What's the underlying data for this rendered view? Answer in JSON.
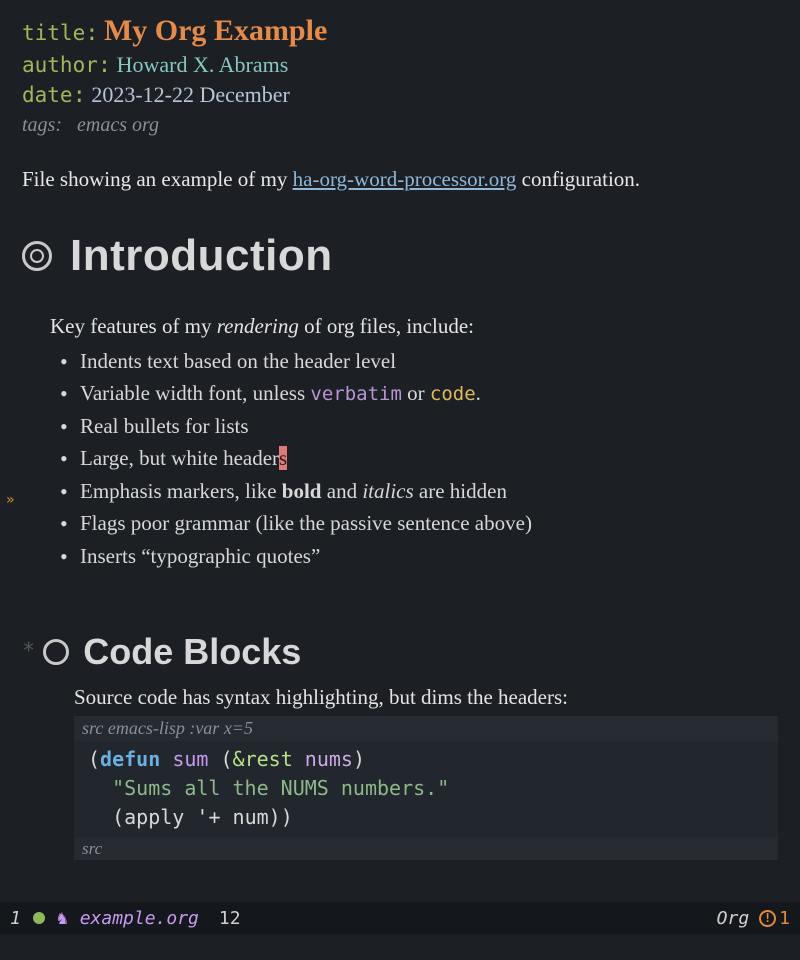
{
  "meta": {
    "title_key": "title",
    "title_val": "My Org Example",
    "author_key": "author",
    "author_val": "Howard X. Abrams",
    "date_key": "date",
    "date_val": "2023-12-22 December",
    "tags_key": "tags:",
    "tags_val": "emacs org"
  },
  "intro": {
    "pre": "File showing an example of my ",
    "link": "ha-org-word-processor.org",
    "post": " configuration."
  },
  "h1": "Introduction",
  "features": {
    "lead_pre": "Key features of my ",
    "lead_ital": "rendering",
    "lead_post": " of org files, include:",
    "items": [
      {
        "text": "Indents text based on the header level"
      },
      {
        "pre": "Variable width font, unless ",
        "verbatim": "verbatim",
        "mid": " or ",
        "code": "code",
        "post": "."
      },
      {
        "text": "Real bullets for lists"
      },
      {
        "pre": "Large, but white header",
        "cursor": "s"
      },
      {
        "pre": "Emphasis markers, like ",
        "bold": "bold",
        "mid": " and ",
        "ital": "italics",
        "post": " are hidden"
      },
      {
        "text": "Flags poor grammar (like the passive sentence above)"
      },
      {
        "text": "Inserts “typographic quotes”"
      }
    ]
  },
  "h2": {
    "star": "*",
    "text": "Code Blocks"
  },
  "codeintro": "Source code has syntax highlighting, but dims the headers:",
  "src": {
    "header_src": "src",
    "header_rest": " emacs-lisp :var x=5",
    "l1_open": "(",
    "l1_kw": "defun",
    "l1_sp": " ",
    "l1_fn": "sum",
    "l1_sp2": " (",
    "l1_amp": "&rest",
    "l1_sp3": " ",
    "l1_arg": "nums",
    "l1_close": ")",
    "l2_str": "\"Sums all the NUMS numbers.\"",
    "l3_open": "(",
    "l3_fn": "apply",
    "l3_mid": " '+ ",
    "l3_sym": "num",
    "l3_close": "))",
    "footer": "src"
  },
  "modeline": {
    "win": "1",
    "file": "example.org",
    "line": "12",
    "mode": "Org",
    "warn": "1",
    "unicorn": "♞"
  },
  "fringe_arrow": "»"
}
